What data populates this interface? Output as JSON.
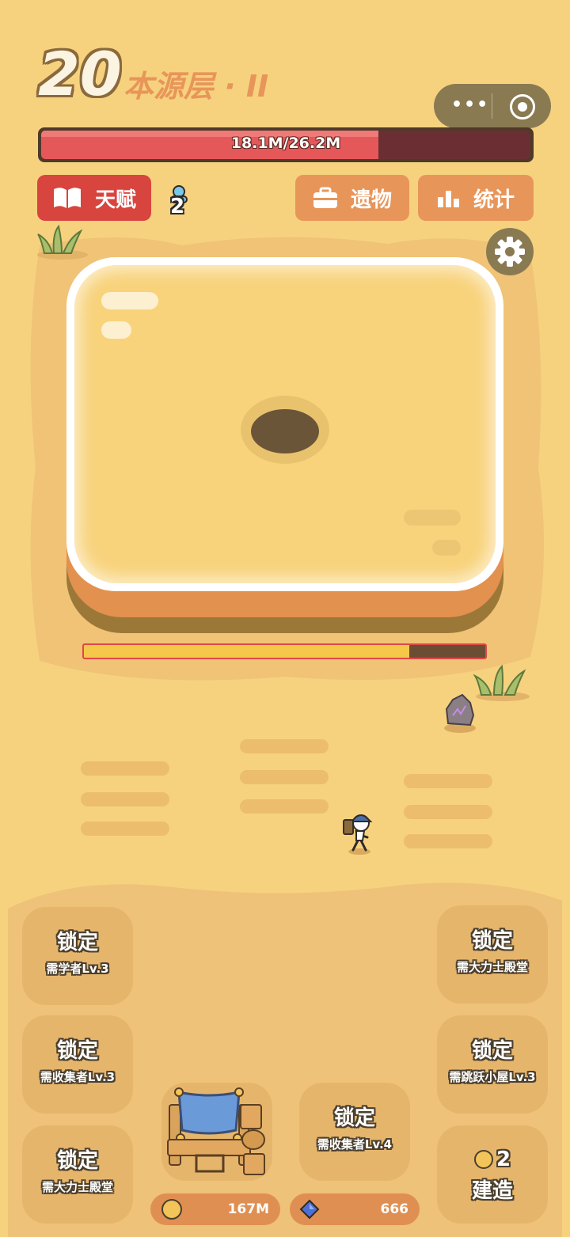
{
  "header": {
    "level": "20",
    "level_name": "本源层 · II",
    "hp_text": "18.1M/26.2M",
    "hp_fraction": 0.69
  },
  "toolbar": {
    "talent_label": "天赋",
    "talent_badge": "2",
    "relic_label": "遗物",
    "stats_label": "统计"
  },
  "mine": {
    "progress_fraction": 0.81
  },
  "buildings": [
    {
      "lock": "锁定",
      "req": "需学者Lv.3"
    },
    {
      "lock": "锁定",
      "req": "需收集者Lv.3"
    },
    {
      "lock": "锁定",
      "req": "需大力士殿堂"
    },
    {
      "lock": "锁定",
      "req": "需大力士殿堂"
    },
    {
      "lock": "锁定",
      "req": "需跳跃小屋Lv.3"
    },
    {
      "lock": "锁定",
      "req": "需收集者Lv.4"
    }
  ],
  "build": {
    "cost": "2",
    "label": "建造"
  },
  "resources": {
    "gold": "167M",
    "gems": "666"
  },
  "colors": {
    "background": "#f6d27f",
    "accent_red": "#d8443e",
    "accent_orange": "#e8955a",
    "hp_fill": "#e4585a"
  }
}
